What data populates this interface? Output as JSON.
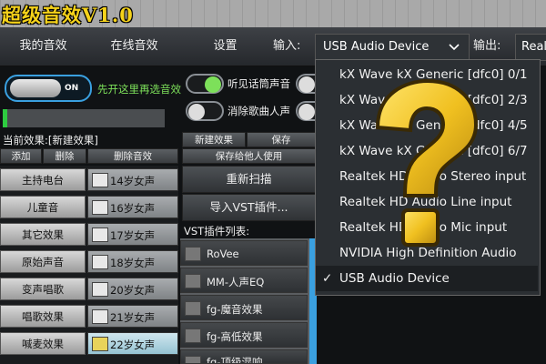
{
  "app": {
    "title": "超级音效V1.0"
  },
  "toolbar": {
    "my_effects": "我的音效",
    "online_effects": "在线音效",
    "settings": "设置",
    "input_label": "输入:",
    "input_value": "USB Audio Device",
    "output_label": "输出:",
    "output_value": "Realte"
  },
  "left": {
    "main_toggle_text": "ON",
    "main_toggle_hint": "先开这里再选音效",
    "mic_toggle": "听见话筒声音",
    "remove_vocal": "消除歌曲人声",
    "current_effect": "当前效果:[新建效果]",
    "add": "添加",
    "delete": "删除",
    "delete_effect": "删除音效",
    "new_effect": "新建效果",
    "save": "保存",
    "save_for_others": "保存给他人使用",
    "rescan": "重新扫描",
    "import_vst": "导入VST插件...",
    "vst_list_label": "VST插件列表:",
    "categories": [
      "主持电台",
      "儿童音",
      "其它效果",
      "原始声音",
      "变声唱歌",
      "唱歌效果",
      "喊麦效果"
    ],
    "presets": [
      "14岁女声",
      "16岁女声",
      "17岁女声",
      "18岁女声",
      "20岁女声",
      "21岁女声",
      "22岁女声"
    ],
    "selected_preset_index": 6,
    "vst_plugins": [
      "RoVee",
      "MM-人声EQ",
      "fg-魔音效果",
      "fg-高低效果",
      "fg-顶级混响"
    ]
  },
  "menu": {
    "items": [
      "kX Wave kX Generic [dfc0] 0/1",
      "kX Wave kX Generic [dfc0] 2/3",
      "kX Wave kX Generic [dfc0] 4/5",
      "kX Wave kX Generic [dfc0] 6/7",
      "Realtek HD Audio Stereo input",
      "Realtek HD Audio Line input",
      "Realtek HD Audio Mic input",
      "NVIDIA High Definition Audio",
      "USB Audio Device"
    ],
    "selected_index": 8,
    "check_mark": "✓"
  },
  "overlay": {
    "symbol": "?"
  },
  "colors": {
    "accent_green": "#7de05a",
    "title_yellow": "#f5d21a",
    "question_gold": "#f0c020"
  }
}
